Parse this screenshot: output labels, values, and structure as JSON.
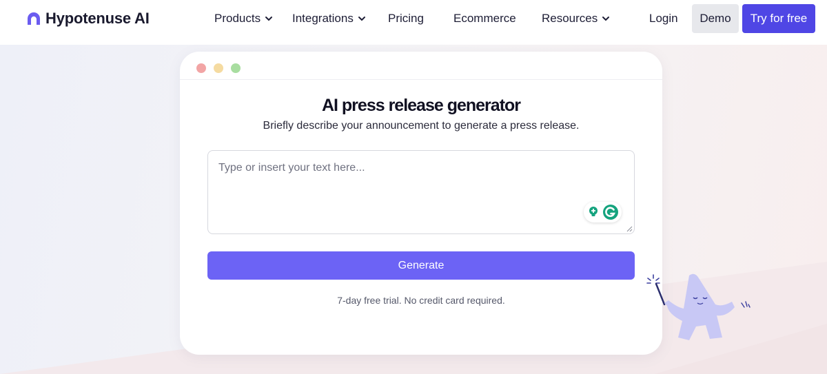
{
  "nav": {
    "brand": "Hypotenuse AI",
    "items": [
      {
        "label": "Products",
        "dropdown": true
      },
      {
        "label": "Integrations",
        "dropdown": true
      },
      {
        "label": "Pricing",
        "dropdown": false
      },
      {
        "label": "Ecommerce",
        "dropdown": false
      },
      {
        "label": "Resources",
        "dropdown": true
      },
      {
        "label": "Login",
        "dropdown": false
      }
    ],
    "demo_label": "Demo",
    "try_label": "Try for free"
  },
  "card": {
    "title": "AI press release generator",
    "subtitle": "Briefly describe your announcement to generate a press release.",
    "input_placeholder": "Type or insert your text here...",
    "input_value": "",
    "generate_label": "Generate",
    "note": "7-day free trial. No credit card required."
  },
  "icons": {
    "brand": "hypotenuse-logo-icon",
    "dropdown": "chevron-down-icon",
    "grammarly_assist": "lightbulb-icon",
    "grammarly": "grammarly-icon",
    "mascot": "wizard-mascot-icon"
  },
  "colors": {
    "brand_purple": "#4f46e5",
    "generate_button": "#6c63f5",
    "grammarly_green": "#15a37e",
    "dot_red": "#f2a5a5",
    "dot_yellow": "#f5dba1",
    "dot_green": "#a8dda0"
  }
}
